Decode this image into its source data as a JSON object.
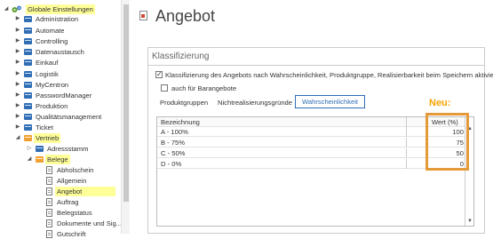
{
  "sidebar": {
    "root_label": "Globale Einstellungen",
    "items": [
      "Administration",
      "Automate",
      "Controlling",
      "Datenaustausch",
      "Einkauf",
      "Logistik",
      "MyCentron",
      "PasswordManager",
      "Produktion",
      "Qualitätsmanagement",
      "Ticket"
    ],
    "vertrieb": "Vertrieb",
    "adressstamm": "Adressstamm",
    "belege": "Belege",
    "belege_children": [
      "Abholschein",
      "Allgemein",
      "Angebot",
      "Auftrag",
      "Belegstatus",
      "Dokumente und Sig...",
      "Gutschrift"
    ]
  },
  "main": {
    "title": "Angebot",
    "section_title": "Klassifizierung",
    "checkbox1_label": "Klassifizierung des Angebots nach Wahrscheinlichkeit, Produktgruppe, Realisierbarkeit beim Speichern aktivieren",
    "checkbox2_label": "auch für Barangebote",
    "tabs": [
      "Produktgruppen",
      "Nichtrealisierungsgründe",
      "Wahrscheinlichkeit"
    ],
    "grid": {
      "col_bezeichnung": "Bezeichnung",
      "col_wert": "Wert (%)",
      "rows": [
        {
          "bezeichnung": "A - 100%",
          "wert": "100"
        },
        {
          "bezeichnung": "B - 75%",
          "wert": "75"
        },
        {
          "bezeichnung": "C - 50%",
          "wert": "50"
        },
        {
          "bezeichnung": "D - 0%",
          "wert": "0"
        }
      ]
    }
  },
  "annotation": {
    "label": "Neu:",
    "color": "#f4a300"
  }
}
